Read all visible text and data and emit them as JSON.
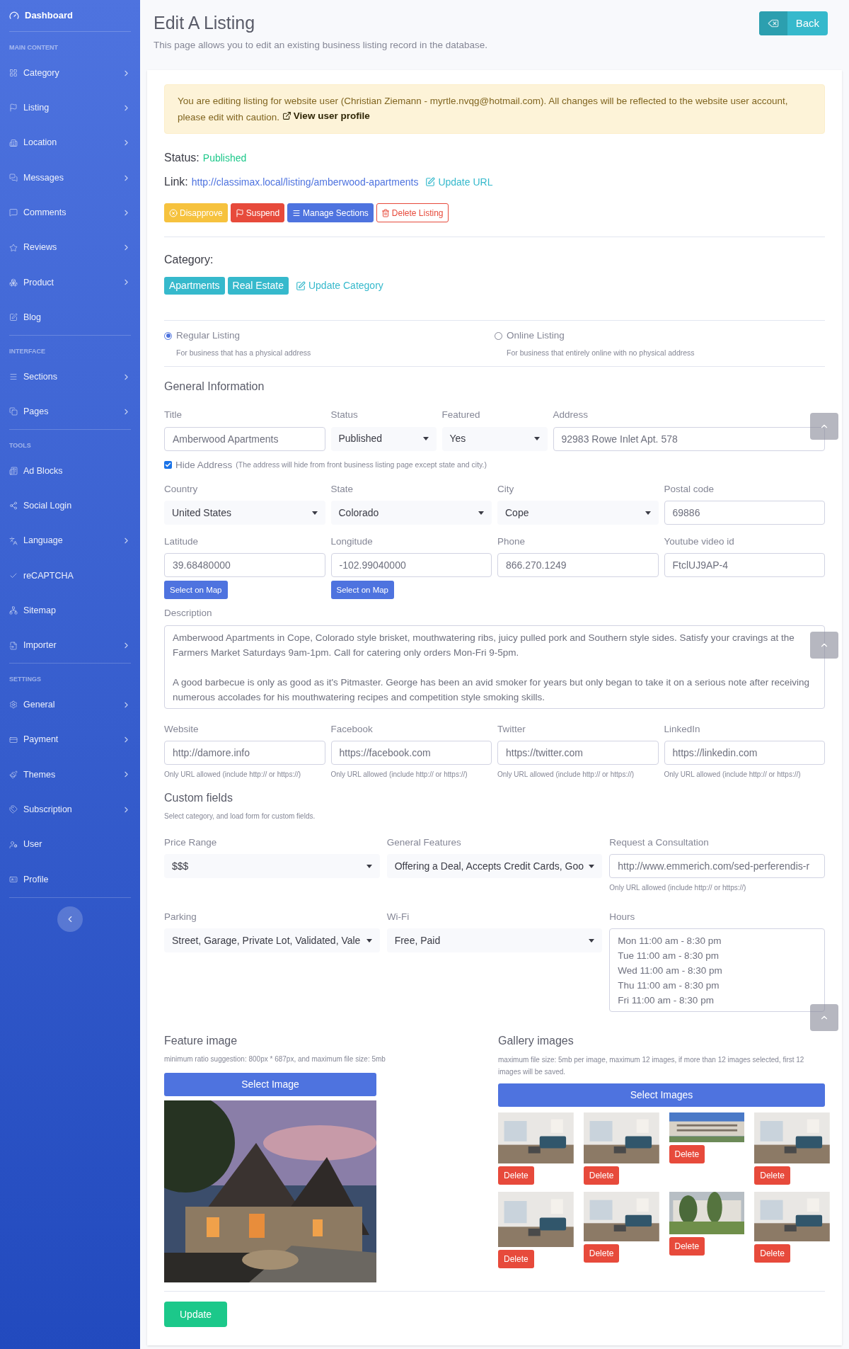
{
  "sidebar": {
    "brand": "Dashboard",
    "sections": [
      {
        "heading": "MAIN CONTENT",
        "items": [
          {
            "label": "Category",
            "has_submenu": true
          },
          {
            "label": "Listing",
            "has_submenu": true
          },
          {
            "label": "Location",
            "has_submenu": true
          },
          {
            "label": "Messages",
            "has_submenu": true
          },
          {
            "label": "Comments",
            "has_submenu": true
          },
          {
            "label": "Reviews",
            "has_submenu": true
          },
          {
            "label": "Product",
            "has_submenu": true
          },
          {
            "label": "Blog",
            "has_submenu": false
          }
        ]
      },
      {
        "heading": "INTERFACE",
        "items": [
          {
            "label": "Sections",
            "has_submenu": true
          },
          {
            "label": "Pages",
            "has_submenu": true
          }
        ]
      },
      {
        "heading": "TOOLS",
        "items": [
          {
            "label": "Ad Blocks",
            "has_submenu": false
          },
          {
            "label": "Social Login",
            "has_submenu": false
          },
          {
            "label": "Language",
            "has_submenu": true
          },
          {
            "label": "reCAPTCHA",
            "has_submenu": false
          },
          {
            "label": "Sitemap",
            "has_submenu": false
          },
          {
            "label": "Importer",
            "has_submenu": true
          }
        ]
      },
      {
        "heading": "SETTINGS",
        "items": [
          {
            "label": "General",
            "has_submenu": true
          },
          {
            "label": "Payment",
            "has_submenu": true
          },
          {
            "label": "Themes",
            "has_submenu": true
          },
          {
            "label": "Subscription",
            "has_submenu": true
          },
          {
            "label": "User",
            "has_submenu": false
          },
          {
            "label": "Profile",
            "has_submenu": false
          }
        ]
      }
    ]
  },
  "page": {
    "title": "Edit A Listing",
    "subtitle": "This page allows you to edit an existing business listing record in the database.",
    "back_button": "Back"
  },
  "alert": {
    "text": "You are editing listing for website user (Christian Ziemann - myrtle.nvqg@hotmail.com). All changes will be reflected to the website user account, please edit with caution.",
    "link": "View user profile"
  },
  "status": {
    "label": "Status:",
    "value": "Published"
  },
  "link": {
    "label": "Link:",
    "url": "http://classimax.local/listing/amberwood-apartments",
    "action": "Update URL"
  },
  "actions": [
    {
      "label": "Disapprove",
      "kind": "warning"
    },
    {
      "label": "Suspend",
      "kind": "danger"
    },
    {
      "label": "Manage Sections",
      "kind": "primary"
    },
    {
      "label": "Delete Listing",
      "kind": "outline-danger"
    }
  ],
  "category": {
    "heading": "Category:",
    "tags": [
      "Apartments",
      "Real Estate"
    ],
    "action": "Update Category"
  },
  "listing_types": [
    {
      "label": "Regular Listing",
      "hint": "For business that has a physical address",
      "selected": true
    },
    {
      "label": "Online Listing",
      "hint": "For business that entirely online with no physical address",
      "selected": false
    }
  ],
  "general_info": {
    "heading": "General Information",
    "row_1": [
      {
        "label": "Title",
        "kind": "input",
        "value": "Amberwood Apartments"
      },
      {
        "label": "Status",
        "kind": "select",
        "value": "Published"
      },
      {
        "label": "Featured",
        "kind": "select",
        "value": "Yes"
      },
      {
        "label": "Address",
        "kind": "input",
        "value": "92983 Rowe Inlet Apt. 578"
      }
    ],
    "hide_address": {
      "label": "Hide Address",
      "note": "(The address will hide from front business listing page except state and city.)",
      "checked": true
    },
    "rows": [
      [
        {
          "label": "Country",
          "kind": "select",
          "value": "United States"
        },
        {
          "label": "State",
          "kind": "select",
          "value": "Colorado"
        },
        {
          "label": "City",
          "kind": "select",
          "value": "Cope"
        },
        {
          "label": "Postal code",
          "kind": "input",
          "value": "69886"
        }
      ],
      [
        {
          "label": "Latitude",
          "kind": "input",
          "value": "39.68480000",
          "button": "Select on Map"
        },
        {
          "label": "Longitude",
          "kind": "input",
          "value": "-102.99040000",
          "button": "Select on Map"
        },
        {
          "label": "Phone",
          "kind": "input",
          "value": "866.270.1249"
        },
        {
          "label": "Youtube video id",
          "kind": "input",
          "value": "FtclUJ9AP-4"
        }
      ]
    ],
    "description": {
      "label": "Description",
      "value": "Amberwood Apartments in Cope, Colorado style brisket, mouthwatering ribs, juicy pulled pork and Southern style sides. Satisfy your cravings at the Farmers Market Saturdays 9am-1pm. Call for catering only orders Mon-Fri 9-5pm.\n\nA good barbecue is only as good as it's Pitmaster. George has been an avid smoker for years but only began to take it on a serious note after receiving numerous accolades for his mouthwatering recipes and competition style smoking skills."
    },
    "social": [
      {
        "label": "Website",
        "kind": "input",
        "value": "http://damore.info",
        "help": "Only URL allowed (include http:// or https://)"
      },
      {
        "label": "Facebook",
        "kind": "input",
        "value": "https://facebook.com",
        "help": "Only URL allowed (include http:// or https://)"
      },
      {
        "label": "Twitter",
        "kind": "input",
        "value": "https://twitter.com",
        "help": "Only URL allowed (include http:// or https://)"
      },
      {
        "label": "LinkedIn",
        "kind": "input",
        "value": "https://linkedin.com",
        "help": "Only URL allowed (include http:// or https://)"
      }
    ]
  },
  "custom_fields": {
    "heading": "Custom fields",
    "hint": "Select category, and load form for custom fields.",
    "rows": [
      [
        {
          "label": "Price Range",
          "kind": "select",
          "value": "$$$"
        },
        {
          "label": "General Features",
          "kind": "select",
          "value": "Offering a Deal, Accepts Credit Cards, Goo"
        },
        {
          "label": "Request a Consultation",
          "kind": "input",
          "value": "http://www.emmerich.com/sed-perferendis-r",
          "help": "Only URL allowed (include http:// or https://)"
        }
      ],
      [
        {
          "label": "Parking",
          "kind": "select",
          "value": "Street, Garage, Private Lot, Validated, Vale"
        },
        {
          "label": "Wi-Fi",
          "kind": "select",
          "value": "Free, Paid"
        },
        {
          "label": "Hours",
          "kind": "textarea",
          "value": "Mon 11:00 am - 8:30 pm\nTue 11:00 am - 8:30 pm\nWed 11:00 am - 8:30 pm\nThu 11:00 am - 8:30 pm\nFri 11:00 am - 8:30 pm"
        }
      ]
    ]
  },
  "feature_image": {
    "heading": "Feature image",
    "hint": "minimum ratio suggestion: 800px * 687px, and maximum file size: 5mb",
    "button": "Select Image"
  },
  "gallery": {
    "heading": "Gallery images",
    "hint": "maximum file size: 5mb per image, maximum 12 images, if more than 12 images selected, first 12 images will be saved.",
    "button": "Select Images",
    "items": [
      {
        "delete": "Delete"
      },
      {
        "delete": "Delete"
      },
      {
        "delete": "Delete"
      },
      {
        "delete": "Delete"
      },
      {
        "delete": "Delete"
      },
      {
        "delete": "Delete"
      },
      {
        "delete": "Delete"
      },
      {
        "delete": "Delete"
      }
    ]
  },
  "update_button": "Update"
}
